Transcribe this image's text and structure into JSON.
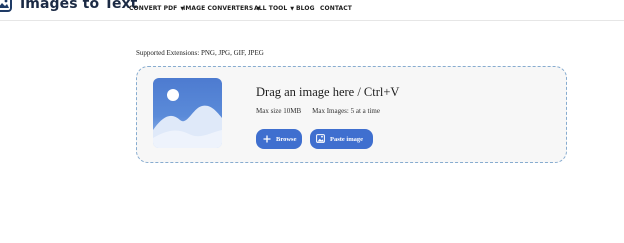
{
  "header": {
    "brand": "Images to Text",
    "nav": [
      {
        "label": "CONVERT PDF",
        "dropdown": true
      },
      {
        "label": "IMAGE CONVERTERS",
        "dropdown": true
      },
      {
        "label": "ALL TOOL",
        "dropdown": true
      },
      {
        "label": "BLOG",
        "dropdown": false
      },
      {
        "label": "CONTACT",
        "dropdown": false
      }
    ],
    "caret_glyph": "▼"
  },
  "upload": {
    "supported_extensions": "Supported Extensions: PNG, JPG, GIF, JPEG",
    "drag_text": "Drag an image here / Ctrl+V",
    "max_size": "Max size 10MB",
    "max_images": "Max Images: 5 at a time",
    "browse_label": "Browse",
    "paste_label": "Paste image",
    "illustration_icon": "image-placeholder-icon"
  },
  "colors": {
    "accent": "#3f6fcf",
    "dropzone_border": "#87acd0",
    "dropzone_bg": "#f7f7f7",
    "brand_text": "#1b2a44"
  }
}
